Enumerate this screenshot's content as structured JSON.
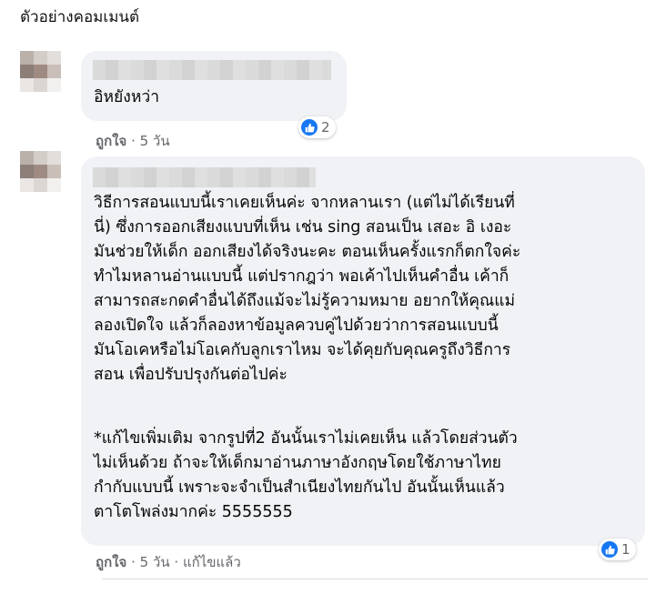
{
  "page": {
    "heading": "ตัวอย่างคอมเมนต์"
  },
  "colors": {
    "bubble_bg": "#f0f2f5",
    "meta_text": "#65676b",
    "like_blue": "#1877f2"
  },
  "comments": [
    {
      "text": "อิหยังหว่า",
      "like_label": "ถูกใจ",
      "time": "5 วัน",
      "edited_label": "",
      "reaction_icon": "like-icon",
      "reaction_count": "2"
    },
    {
      "text": "วิธีการสอนแบบนี้เราเคยเห็นค่ะ จากหลานเรา (แต่ไม่ได้เรียนที่\nนี่) ซึ่งการออกเสียงแบบที่เห็น เช่น sing สอนเป็น เสอะ อิ เงอะ\nมันช่วยให้เด็ก ออกเสียงได้จริงนะคะ ตอนเห็นครั้งแรกก็ตกใจค่ะ\nทำไมหลานอ่านแบบนี้ แต่ปรากฎว่า พอเค้าไปเห็นคำอื่น เค้าก็\nสามารถสะกดคำอื่นได้ถึงแม้จะไม่รู้ความหมาย อยากให้คุณแม่\nลองเปิดใจ แล้วก็ลองหาข้อมูลควบคู่ไปด้วยว่าการสอนแบบนี้\nมันโอเคหรือไม่โอเคกับลูกเราไหม จะได้คุยกับคุณครูถึงวิธีการ\nสอน เพื่อปรับปรุงกันต่อไปค่ะ",
      "text_2": "*แก้ไขเพิ่มเติม จากรูปที่2 อันนั้นเราไม่เคยเห็น แล้วโดยส่วนตัว\nไม่เห็นด้วย ถ้าจะให้เด็กมาอ่านภาษาอังกฤษโดยใช้ภาษาไทย\nกำกับแบบนี้ เพราะจะจำเป็นสำเนียงไทยกันไป อันนั้นเห็นแล้ว\nตาโตโพล่งมากค่ะ 5555555",
      "like_label": "ถูกใจ",
      "time": "5 วัน",
      "edited_label": "แก้ไขแล้ว",
      "reaction_icon": "like-icon",
      "reaction_count": "1"
    }
  ]
}
